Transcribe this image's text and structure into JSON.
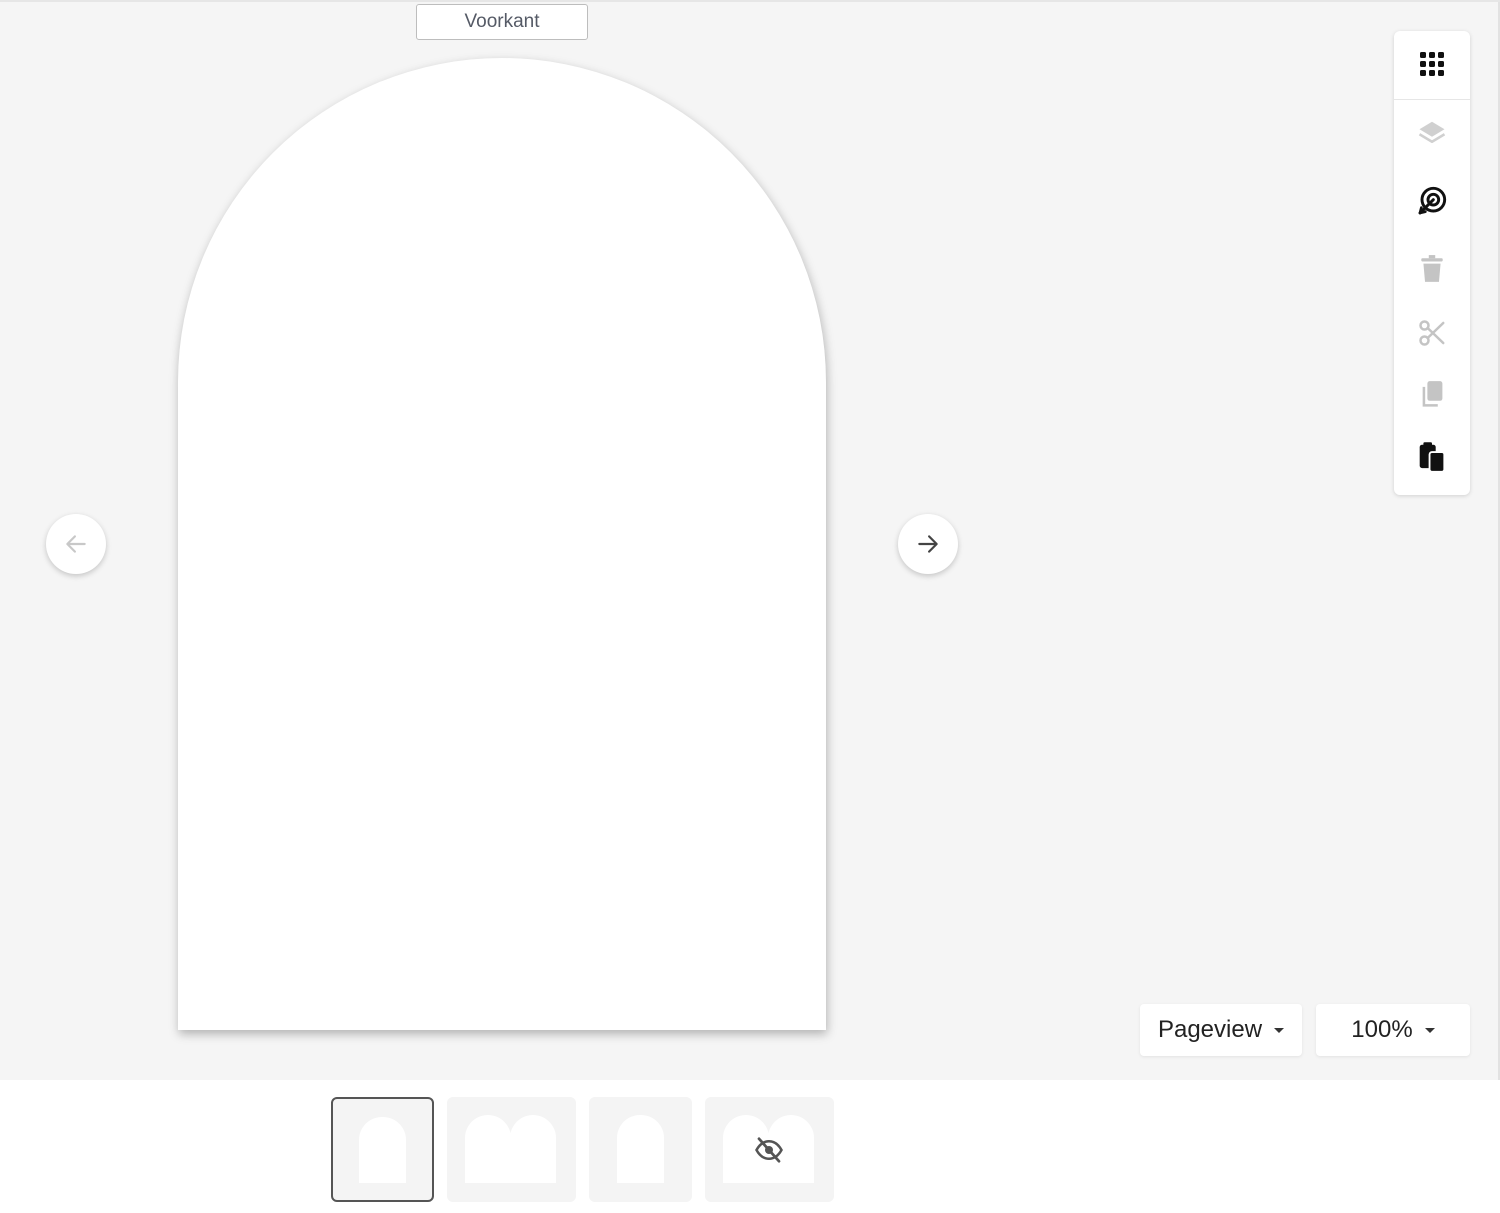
{
  "editor": {
    "page_label": "Voorkant"
  },
  "toolbar": {
    "tools": [
      {
        "name": "grid-icon",
        "enabled": true
      },
      {
        "name": "layers-icon",
        "enabled": false
      },
      {
        "name": "magic-target-icon",
        "enabled": true
      },
      {
        "name": "trash-icon",
        "enabled": false
      },
      {
        "name": "scissors-icon",
        "enabled": false
      },
      {
        "name": "copy-icon",
        "enabled": false
      },
      {
        "name": "paste-icon",
        "enabled": true
      }
    ]
  },
  "view": {
    "mode_selected": "Pageview",
    "zoom_selected": "100%"
  },
  "colors": {
    "canvas_bg": "#f5f5f5",
    "active_icon": "#111111",
    "disabled_icon": "#c4c4c4"
  },
  "pages": {
    "selected_index": 0,
    "count": 4,
    "hidden_page_icon": "eye-off-icon"
  }
}
